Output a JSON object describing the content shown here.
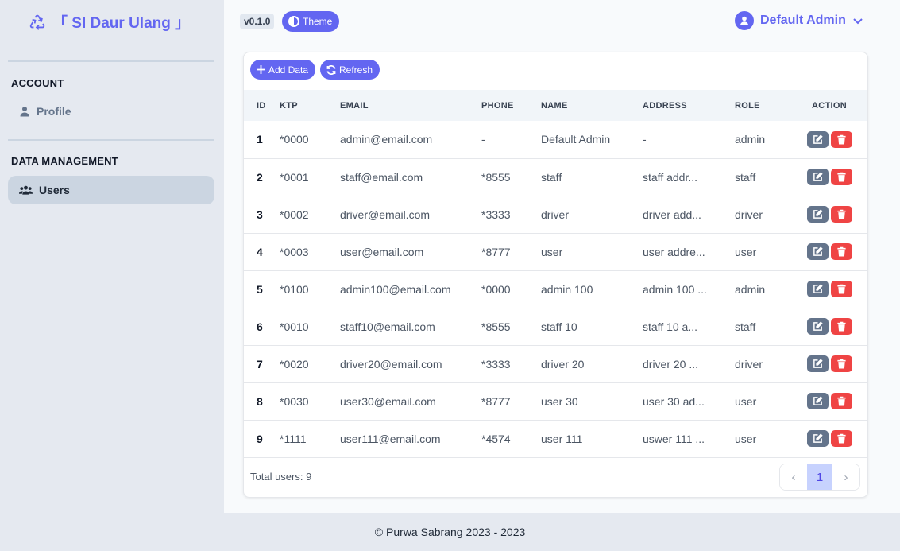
{
  "app": {
    "title": "「 SI Daur Ulang 」",
    "version": "v0.1.0",
    "theme_label": "Theme"
  },
  "colors": {
    "accent": "#6366f1",
    "danger": "#ef4444",
    "muted": "#64748b"
  },
  "user_menu": {
    "name": "Default Admin",
    "icon": "user-circle-icon"
  },
  "sidebar": {
    "sections": [
      {
        "title": "ACCOUNT",
        "items": [
          {
            "label": "Profile",
            "icon": "user-icon"
          }
        ]
      },
      {
        "title": "DATA MANAGEMENT",
        "items": [
          {
            "label": "Users",
            "icon": "users-icon",
            "active": true
          }
        ]
      }
    ]
  },
  "toolbar": {
    "add_label": "Add Data",
    "refresh_label": "Refresh"
  },
  "table": {
    "columns": [
      "ID",
      "KTP",
      "EMAIL",
      "PHONE",
      "NAME",
      "ADDRESS",
      "ROLE",
      "ACTION"
    ],
    "rows": [
      {
        "id": "1",
        "ktp": "*0000",
        "email": "admin@email.com",
        "phone": "-",
        "name": "Default Admin",
        "address": "-",
        "role": "admin"
      },
      {
        "id": "2",
        "ktp": "*0001",
        "email": "staff@email.com",
        "phone": "*8555",
        "name": "staff",
        "address": "staff addr...",
        "role": "staff"
      },
      {
        "id": "3",
        "ktp": "*0002",
        "email": "driver@email.com",
        "phone": "*3333",
        "name": "driver",
        "address": "driver add...",
        "role": "driver"
      },
      {
        "id": "4",
        "ktp": "*0003",
        "email": "user@email.com",
        "phone": "*8777",
        "name": "user",
        "address": "user addre...",
        "role": "user"
      },
      {
        "id": "5",
        "ktp": "*0100",
        "email": "admin100@email.com",
        "phone": "*0000",
        "name": "admin 100",
        "address": "admin 100 ...",
        "role": "admin"
      },
      {
        "id": "6",
        "ktp": "*0010",
        "email": "staff10@email.com",
        "phone": "*8555",
        "name": "staff 10",
        "address": "staff 10 a...",
        "role": "staff"
      },
      {
        "id": "7",
        "ktp": "*0020",
        "email": "driver20@email.com",
        "phone": "*3333",
        "name": "driver 20",
        "address": "driver 20 ...",
        "role": "driver"
      },
      {
        "id": "8",
        "ktp": "*0030",
        "email": "user30@email.com",
        "phone": "*8777",
        "name": "user 30",
        "address": "user 30 ad...",
        "role": "user"
      },
      {
        "id": "9",
        "ktp": "*1111",
        "email": "user111@email.com",
        "phone": "*4574",
        "name": "user 111",
        "address": "uswer 111 ...",
        "role": "user"
      }
    ],
    "total_text": "Total users: 9"
  },
  "pagination": {
    "current": "1",
    "prev_icon": "chevron-left-icon",
    "next_icon": "chevron-right-icon"
  },
  "footer": {
    "prefix": "©",
    "link": "Purwa Sabrang",
    "suffix": "2023 - 2023"
  }
}
